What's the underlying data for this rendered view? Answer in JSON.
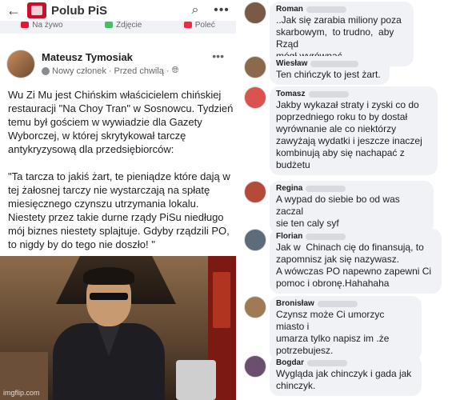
{
  "topbar": {
    "back_glyph": "←",
    "page_name": "Polub PiS",
    "search_glyph": "🔍",
    "more_glyph": "•••"
  },
  "actions": [
    {
      "label": "Na żywo",
      "color": "#e4163a"
    },
    {
      "label": "Zdjęcie",
      "color": "#45bd62"
    },
    {
      "label": "Poleć",
      "color": "#f02849"
    }
  ],
  "post": {
    "author": "Mateusz Tymosiak",
    "role": "Nowy członek",
    "time": "Przed chwilą",
    "more_glyph": "•••",
    "text": "Wu Zi Mu jest Chińskim właścicielem chińskiej restauracji \"Na Choy Tran\" w Sosnowcu. Tydzień temu był gościem w wywiadzie dla Gazety Wyborczej, w której skrytykował tarczę antykryzysową dla przedsiębiorców:\n\n\"Ta tarcza to jakiś żart, te pieniądze które dają w tej żałosnej tarczy nie wystarczają na spłatę miesięcznego czynszu utrzymania lokalu. Niestety przez takie durne rządy PiSu niedługo mój biznes niestety splajtuje. Gdyby rządzili PO, to nigdy by do tego nie doszło! \""
  },
  "meme": {
    "watermark": "imgflip.com"
  },
  "comments": [
    {
      "name": "Roman",
      "text": "..Jak się zarabia miliony poza\nskarbowym,  to trudno,  aby Rząd\nmógł wyrównać ...",
      "avatar_color": "#7a5a46"
    },
    {
      "name": "Wiesław",
      "text": "Ten chińczyk to jest żart.",
      "avatar_color": "#8a6a4a"
    },
    {
      "name": "Tomasz",
      "text": "Jakby wykazał straty i zyski co do\npoprzedniego roku to by dostał\nwyrównanie ale co niektórzy\nzawyżają wydatki i jeszcze inaczej\nkombinują aby się nachapać z\nbudżetu",
      "avatar_color": "#d9534f"
    },
    {
      "name": "Regina",
      "text": "A wypad do siebie bo od was zaczal\nsie ten caly syf",
      "avatar_color": "#b44a3a"
    },
    {
      "name": "Florian",
      "text": "Jak w  Chinach cię do finansują, to\nzapomnisz jak się nazywasz.\nA wówczas PO napewno zapewni Ci\npomoc i obronę.Hahahaha",
      "avatar_color": "#5d6b7a"
    },
    {
      "name": "Bronisław",
      "text": "Czynsz może Ci umorzyc miasto i\numarza tylko napisz im .że\npotrzebujesz.",
      "avatar_color": "#a07a55"
    },
    {
      "name": "Bogdar",
      "text": "Wygląda jak chinczyk i gada jak\nchinczyk.",
      "avatar_color": "#6a4f6f"
    }
  ]
}
